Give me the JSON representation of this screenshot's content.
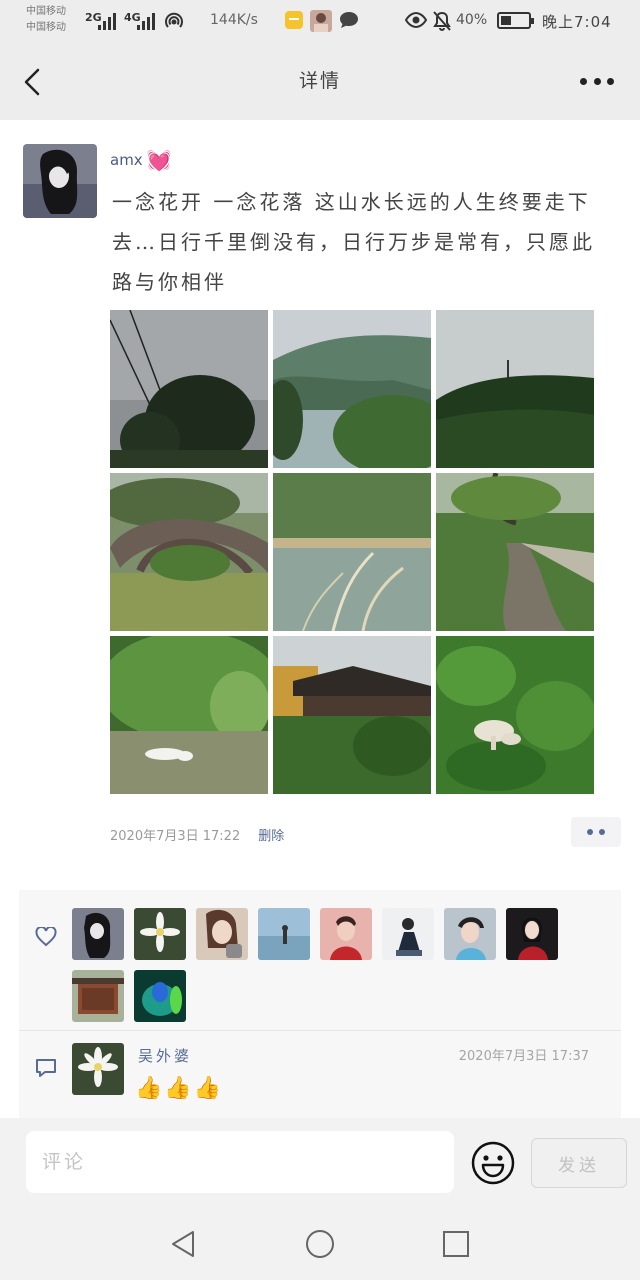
{
  "status_bar": {
    "carrier_line1": "中国移动",
    "carrier_line2": "中国移动",
    "net1": "2G",
    "net2": "4G",
    "net_speed": "144K/s",
    "battery_text": "40%",
    "battery_level": 0.4,
    "time": "晚上7:04"
  },
  "navbar": {
    "title": "详情"
  },
  "post": {
    "author": "amx",
    "author_emoji": "💓",
    "text": "一念花开 一念花落 这山水长远的人生终要走下去…日行千里倒没有，日行万步是常有，只愿此路与你相伴",
    "photos": [
      "photo-power-lines-tree",
      "photo-mountain-lake",
      "photo-forest-hill",
      "photo-stone-arch-bridge",
      "photo-reed-pond",
      "photo-stream-path",
      "photo-ducks-pond",
      "photo-temple",
      "photo-mushrooms"
    ],
    "time": "2020年7月3日 17:22",
    "delete_label": "删除"
  },
  "likes": {
    "icon": "heart-icon",
    "count": 11
  },
  "comment": {
    "icon": "comment-bubble-icon",
    "author": "吴外婆",
    "time": "2020年7月3日 17:37",
    "text": "👍👍👍"
  },
  "input_bar": {
    "placeholder": "评论",
    "send_label": "发送"
  },
  "colors": {
    "link": "#576b95",
    "background": "#ededed",
    "card": "#ffffff"
  }
}
